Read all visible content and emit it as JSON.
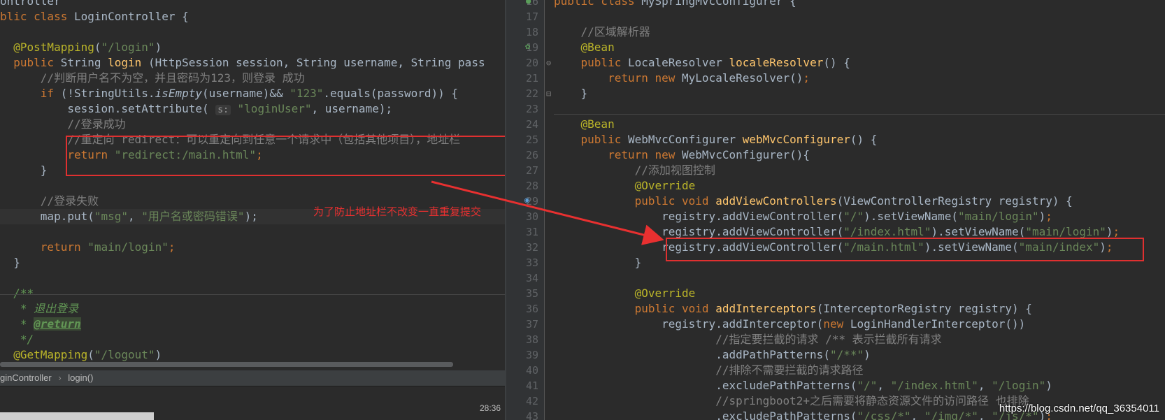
{
  "left": {
    "lines": [
      [
        [
          "",
          "ontroller"
        ]
      ],
      [
        [
          "kw",
          "blic class "
        ],
        [
          "",
          "LoginController {"
        ]
      ],
      [
        [
          "",
          ""
        ]
      ],
      [
        [
          "",
          ""
        ],
        [
          "ann",
          "  @PostMapping"
        ],
        [
          "",
          "("
        ],
        [
          "str",
          "\"/login\""
        ],
        [
          "",
          ")"
        ]
      ],
      [
        [
          "kw",
          "  public "
        ],
        [
          "",
          "String "
        ],
        [
          "fn",
          "login "
        ],
        [
          "",
          "(HttpSession session, String username, String pass"
        ]
      ],
      [
        [
          "cm",
          "      //判断用户名不为空，并且密码为123，则登录 成功"
        ]
      ],
      [
        [
          "kw",
          "      if "
        ],
        [
          "",
          "(!StringUtils."
        ],
        [
          "it",
          "isEmpty"
        ],
        [
          "",
          "(username)&& "
        ],
        [
          "str",
          "\"123\""
        ],
        [
          "",
          ".equals(password)) {"
        ]
      ],
      [
        [
          "",
          "          session.setAttribute( "
        ],
        [
          "hint",
          "s:"
        ],
        [
          "str",
          " \"loginUser\""
        ],
        [
          "",
          ", username);"
        ]
      ],
      [
        [
          "cm",
          "          //登录成功"
        ]
      ],
      [
        [
          "cm",
          "          //重定向 redirect：可以重定向到任意一个请求中（包括其他项目），地址栏"
        ]
      ],
      [
        [
          "kw",
          "          return "
        ],
        [
          "str",
          "\"redirect:/main.html\""
        ],
        [
          "kw",
          ";"
        ]
      ],
      [
        [
          "",
          "      }"
        ]
      ],
      [
        [
          "",
          ""
        ]
      ],
      [
        [
          "cm",
          "      //登录失败"
        ]
      ],
      [
        [
          "",
          "      map.put("
        ],
        [
          "str",
          "\"msg\""
        ],
        [
          "",
          ", "
        ],
        [
          "str",
          "\"用户名或密码错误\""
        ],
        [
          "",
          "); "
        ]
      ],
      [
        [
          "",
          ""
        ]
      ],
      [
        [
          "kw",
          "      return "
        ],
        [
          "str",
          "\"main/login\""
        ],
        [
          "kw",
          ";"
        ]
      ],
      [
        [
          "",
          "  }"
        ]
      ],
      [
        [
          "",
          ""
        ]
      ],
      [
        [
          "doc",
          "  /**"
        ]
      ],
      [
        [
          "doc",
          "   * 退出登录"
        ]
      ],
      [
        [
          "doc",
          "   * "
        ],
        [
          "tag",
          "@return"
        ]
      ],
      [
        [
          "doc",
          "   */"
        ]
      ],
      [
        [
          "ann",
          "  @GetMapping"
        ],
        [
          "",
          "("
        ],
        [
          "str",
          "\"/logout\""
        ],
        [
          "",
          ")"
        ]
      ]
    ],
    "breadcrumb_class": "ginController",
    "breadcrumb_sep": "›",
    "breadcrumb_method": "login()",
    "clock": "28:36"
  },
  "annotation_text": "为了防止地址栏不改变一直重复提交",
  "right": {
    "line_numbers": [
      "16",
      "17",
      "18",
      "19",
      "20",
      "21",
      "22",
      "23",
      "24",
      "25",
      "26",
      "27",
      "28",
      "29",
      "30",
      "31",
      "32",
      "33",
      "34",
      "35",
      "36",
      "37",
      "38",
      "39",
      "40",
      "41",
      "42",
      "43"
    ],
    "lines": [
      [
        [
          "kw",
          "public class "
        ],
        [
          "",
          "MySpringMvcConfigurer {"
        ]
      ],
      [
        [
          "",
          ""
        ]
      ],
      [
        [
          "cm",
          "    //区域解析器"
        ]
      ],
      [
        [
          "ann",
          "    @Bean"
        ]
      ],
      [
        [
          "kw",
          "    public "
        ],
        [
          "",
          "LocaleResolver "
        ],
        [
          "fn",
          "localeResolver"
        ],
        [
          "",
          "() {"
        ]
      ],
      [
        [
          "kw",
          "        return new "
        ],
        [
          "",
          "MyLocaleResolver()"
        ],
        [
          "kw",
          ";"
        ]
      ],
      [
        [
          "",
          "    }"
        ]
      ],
      [
        [
          "",
          ""
        ]
      ],
      [
        [
          "ann",
          "    @Bean"
        ]
      ],
      [
        [
          "kw",
          "    public "
        ],
        [
          "",
          "WebMvcConfigurer "
        ],
        [
          "fn",
          "webMvcConfigurer"
        ],
        [
          "",
          "() {"
        ]
      ],
      [
        [
          "kw",
          "        return new "
        ],
        [
          "",
          "WebMvcConfigurer(){"
        ]
      ],
      [
        [
          "cm",
          "            //添加视图控制"
        ]
      ],
      [
        [
          "ann",
          "            @Override"
        ]
      ],
      [
        [
          "kw",
          "            public void "
        ],
        [
          "fn",
          "addViewControllers"
        ],
        [
          "",
          "(ViewControllerRegistry registry) {"
        ]
      ],
      [
        [
          "",
          "                registry.addViewController("
        ],
        [
          "str",
          "\"/\""
        ],
        [
          "",
          ").setViewName("
        ],
        [
          "str",
          "\"main/login\""
        ],
        [
          "",
          ")"
        ],
        [
          "kw",
          ";"
        ]
      ],
      [
        [
          "",
          "                registry.addViewController("
        ],
        [
          "str",
          "\"/index.html\""
        ],
        [
          "",
          ").setViewName("
        ],
        [
          "str",
          "\"main/login\""
        ],
        [
          "",
          ")"
        ],
        [
          "kw",
          ";"
        ]
      ],
      [
        [
          "",
          "                registry.addViewController("
        ],
        [
          "str",
          "\"/main.html\""
        ],
        [
          "",
          ").setViewName("
        ],
        [
          "str",
          "\"main/index\""
        ],
        [
          "",
          ")"
        ],
        [
          "kw",
          ";"
        ]
      ],
      [
        [
          "",
          "            }"
        ]
      ],
      [
        [
          "",
          ""
        ]
      ],
      [
        [
          "ann",
          "            @Override"
        ]
      ],
      [
        [
          "kw",
          "            public void "
        ],
        [
          "fn",
          "addInterceptors"
        ],
        [
          "",
          "(InterceptorRegistry registry) {"
        ]
      ],
      [
        [
          "",
          "                registry.addInterceptor("
        ],
        [
          "kw",
          "new "
        ],
        [
          "",
          "LoginHandlerInterceptor())"
        ]
      ],
      [
        [
          "cm",
          "                        //指定要拦截的请求 /** 表示拦截所有请求"
        ]
      ],
      [
        [
          "",
          "                        .addPathPatterns("
        ],
        [
          "str",
          "\"/**\""
        ],
        [
          "",
          ")"
        ]
      ],
      [
        [
          "cm",
          "                        //排除不需要拦截的请求路径"
        ]
      ],
      [
        [
          "",
          "                        .excludePathPatterns("
        ],
        [
          "str",
          "\"/\""
        ],
        [
          "",
          ", "
        ],
        [
          "str",
          "\"/index.html\""
        ],
        [
          "",
          ", "
        ],
        [
          "str",
          "\"/login\""
        ],
        [
          "",
          ")"
        ]
      ],
      [
        [
          "cm",
          "                        //springboot2+之后需要将静态资源文件的访问路径 也排除"
        ]
      ],
      [
        [
          "",
          "                        .excludePathPatterns("
        ],
        [
          "str",
          "\"/css/*\""
        ],
        [
          "",
          ", "
        ],
        [
          "str",
          "\"/img/*\""
        ],
        [
          "",
          ", "
        ],
        [
          "str",
          "\"/js/*\""
        ],
        [
          "",
          ")"
        ],
        [
          "kw",
          ";"
        ]
      ]
    ]
  },
  "watermark": "https://blog.csdn.net/qq_36354011"
}
